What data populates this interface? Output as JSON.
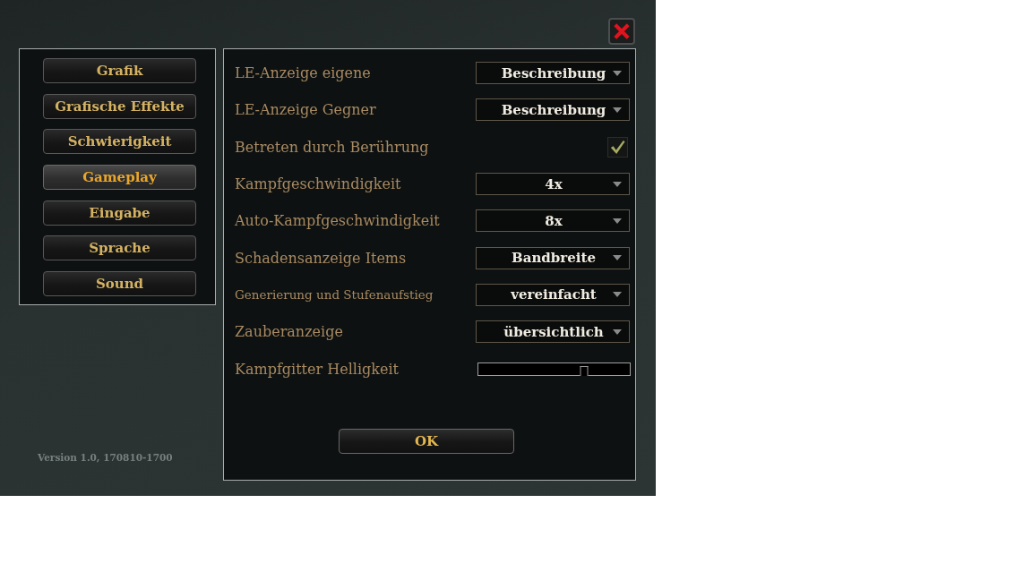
{
  "sidebar": {
    "items": [
      {
        "label": "Grafik",
        "selected": false
      },
      {
        "label": "Grafische Effekte",
        "selected": false
      },
      {
        "label": "Schwierigkeit",
        "selected": false
      },
      {
        "label": "Gameplay",
        "selected": true
      },
      {
        "label": "Eingabe",
        "selected": false
      },
      {
        "label": "Sprache",
        "selected": false
      },
      {
        "label": "Sound",
        "selected": false
      }
    ]
  },
  "version": "Version 1.0, 170810-1700",
  "settings": [
    {
      "kind": "dropdown",
      "label": "LE-Anzeige eigene",
      "value": "Beschreibung"
    },
    {
      "kind": "dropdown",
      "label": "LE-Anzeige Gegner",
      "value": "Beschreibung"
    },
    {
      "kind": "checkbox",
      "label": "Betreten durch Berührung",
      "checked": true
    },
    {
      "kind": "dropdown",
      "label": "Kampfgeschwindigkeit",
      "value": "4x"
    },
    {
      "kind": "dropdown",
      "label": "Auto-Kampfgeschwindigkeit",
      "value": "8x"
    },
    {
      "kind": "dropdown",
      "label": "Schadensanzeige Items",
      "value": "Bandbreite"
    },
    {
      "kind": "dropdown",
      "label": "Generierung und Stufenaufstieg",
      "value": "vereinfacht"
    },
    {
      "kind": "dropdown",
      "label": "Zauberanzeige",
      "value": "übersichtlich"
    },
    {
      "kind": "slider",
      "label": "Kampfgitter Helligkeit",
      "level": 0.7
    }
  ],
  "ok_button": "OK"
}
